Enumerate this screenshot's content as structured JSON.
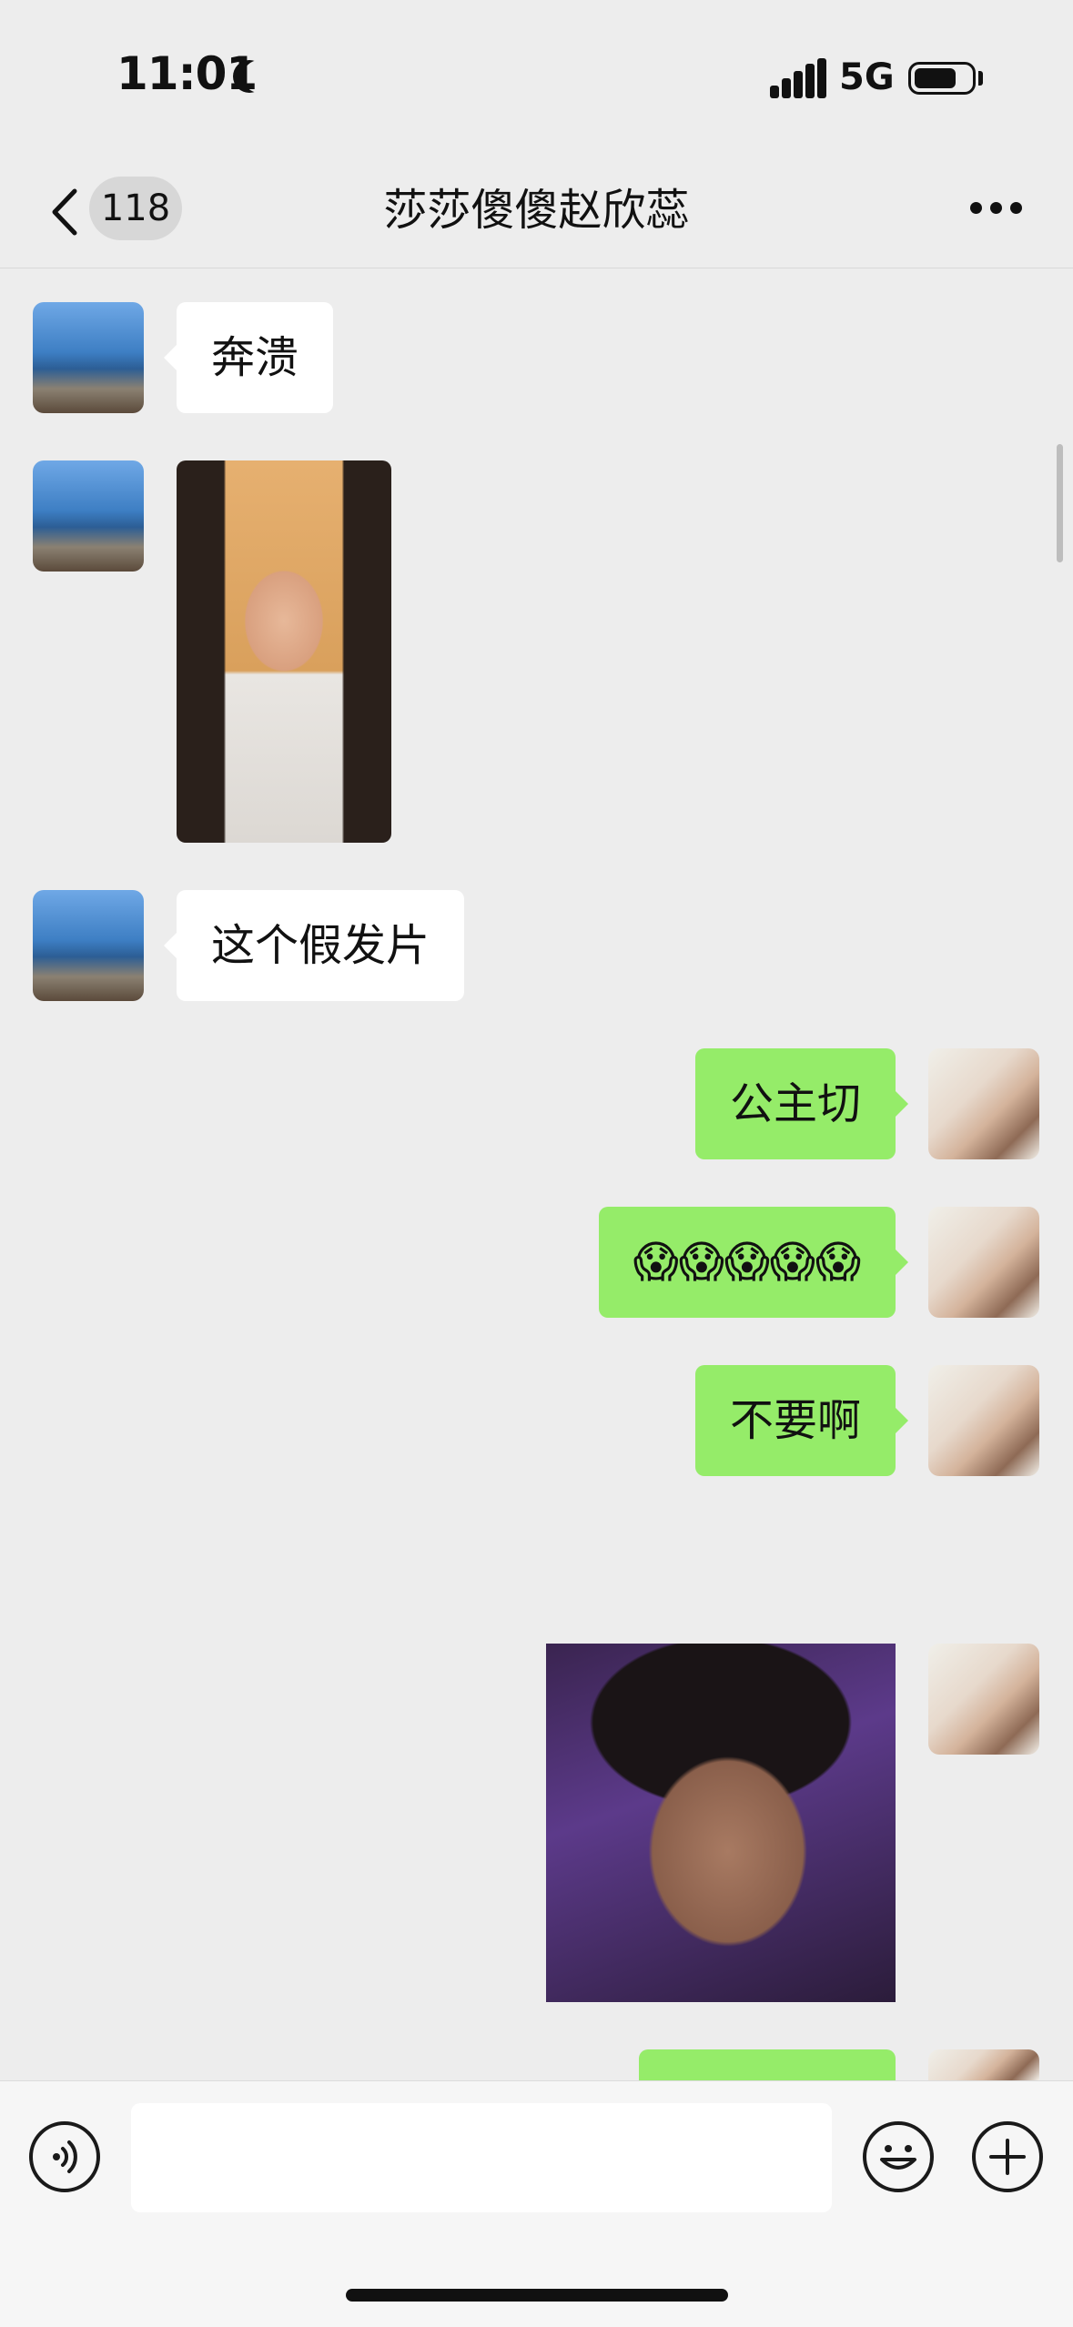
{
  "status_bar": {
    "time": "11:01",
    "network": "5G",
    "battery_level": 0.75,
    "icons": [
      "moon-icon",
      "signal-icon",
      "battery-icon"
    ]
  },
  "nav": {
    "back_icon": "chevron-left-icon",
    "unread_count": "118",
    "title": "莎莎傻傻赵欣蕊",
    "more_icon": "ellipsis-icon"
  },
  "messages": [
    {
      "direction": "incoming",
      "type": "text",
      "text": "奔溃"
    },
    {
      "direction": "incoming",
      "type": "image",
      "image": "selfie-photo"
    },
    {
      "direction": "incoming",
      "type": "text",
      "text": "这个假发片"
    },
    {
      "direction": "outgoing",
      "type": "text",
      "text": "公主切"
    },
    {
      "direction": "outgoing",
      "type": "text",
      "text": "😱😱😱😱😱"
    },
    {
      "direction": "outgoing",
      "type": "text",
      "text": "不要啊"
    },
    {
      "direction": "outgoing",
      "type": "image",
      "image": "meme-photo"
    },
    {
      "direction": "outgoing",
      "type": "text",
      "text": ""
    }
  ],
  "input_bar": {
    "voice_icon": "voice-icon",
    "placeholder": "",
    "emoji_icon": "emoji-icon",
    "plus_icon": "plus-icon"
  },
  "colors": {
    "background": "#ededed",
    "outgoing_bubble": "#95ec69",
    "incoming_bubble": "#ffffff"
  }
}
